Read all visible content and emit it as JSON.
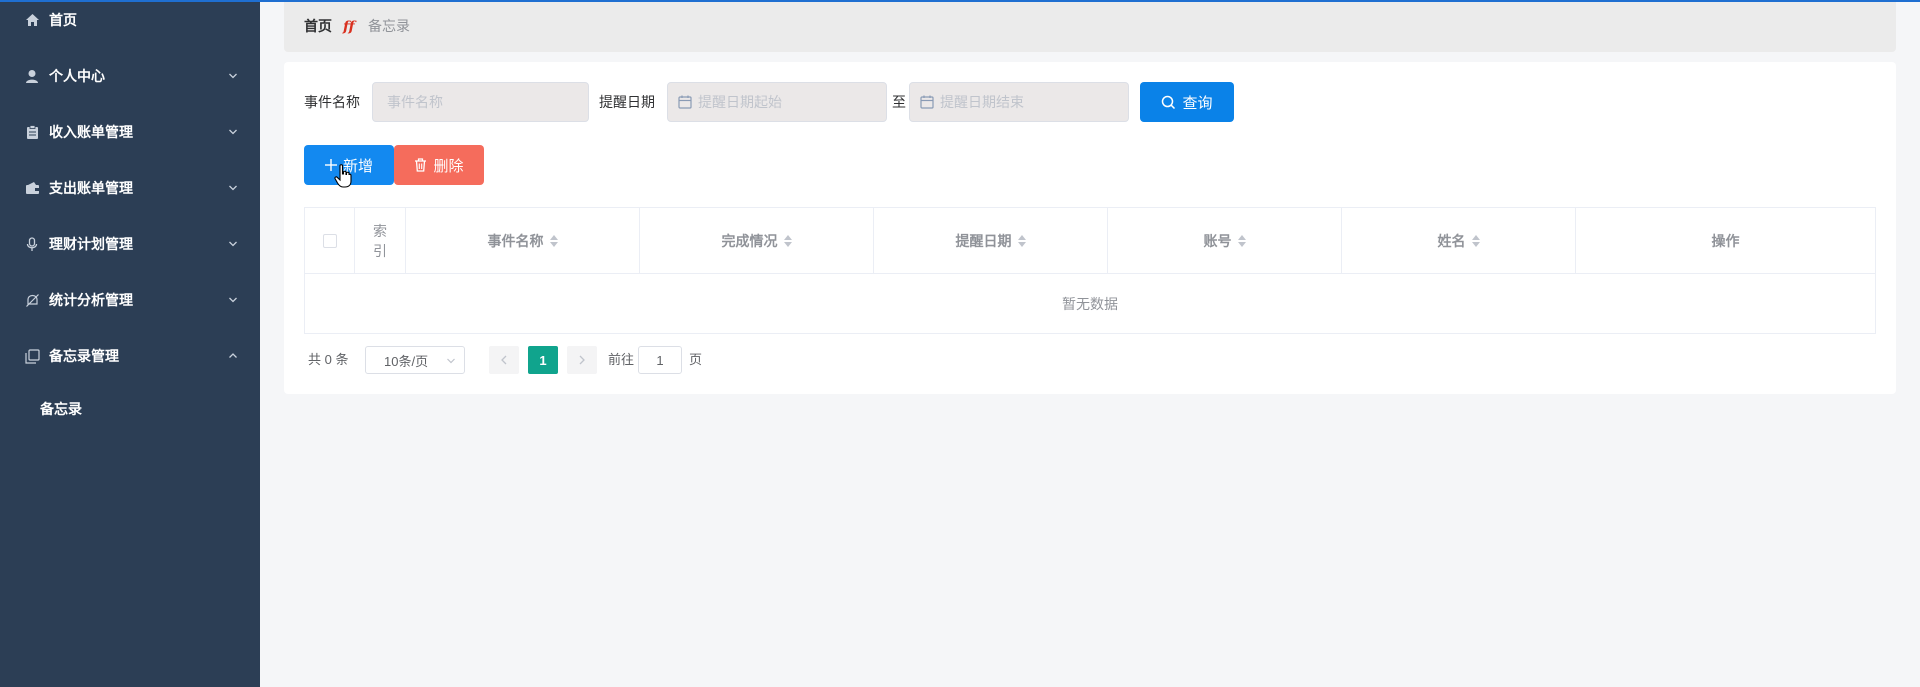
{
  "sidebar": {
    "items": [
      {
        "label": "首页",
        "icon": "home-icon"
      },
      {
        "label": "个人中心",
        "icon": "user-icon"
      },
      {
        "label": "收入账单管理",
        "icon": "clipboard-icon"
      },
      {
        "label": "支出账单管理",
        "icon": "wallet-icon"
      },
      {
        "label": "理财计划管理",
        "icon": "microphone-icon"
      },
      {
        "label": "统计分析管理",
        "icon": "bell-off-icon"
      },
      {
        "label": "备忘录管理",
        "icon": "copy-icon"
      }
    ],
    "submenu": {
      "label": "备忘录"
    }
  },
  "breadcrumb": {
    "home": "首页",
    "current": "备忘录"
  },
  "search": {
    "event_label": "事件名称",
    "event_placeholder": "事件名称",
    "date_label": "提醒日期",
    "date_start_placeholder": "提醒日期起始",
    "date_to": "至",
    "date_end_placeholder": "提醒日期结束",
    "query_button": "查询"
  },
  "actions": {
    "add": "新增",
    "delete": "删除"
  },
  "table": {
    "columns": [
      "索引",
      "事件名称",
      "完成情况",
      "提醒日期",
      "账号",
      "姓名",
      "操作"
    ],
    "index_line1": "索",
    "index_line2": "引",
    "empty_text": "暂无数据"
  },
  "pagination": {
    "total": "共 0 条",
    "page_size": "10条/页",
    "current_page": "1",
    "goto_label": "前往",
    "goto_value": "1",
    "page_suffix": "页"
  },
  "colors": {
    "sidebar_bg": "#2c3e55",
    "primary": "#0a82e8",
    "danger": "#f56c5c",
    "pager_active": "#10a48d"
  }
}
